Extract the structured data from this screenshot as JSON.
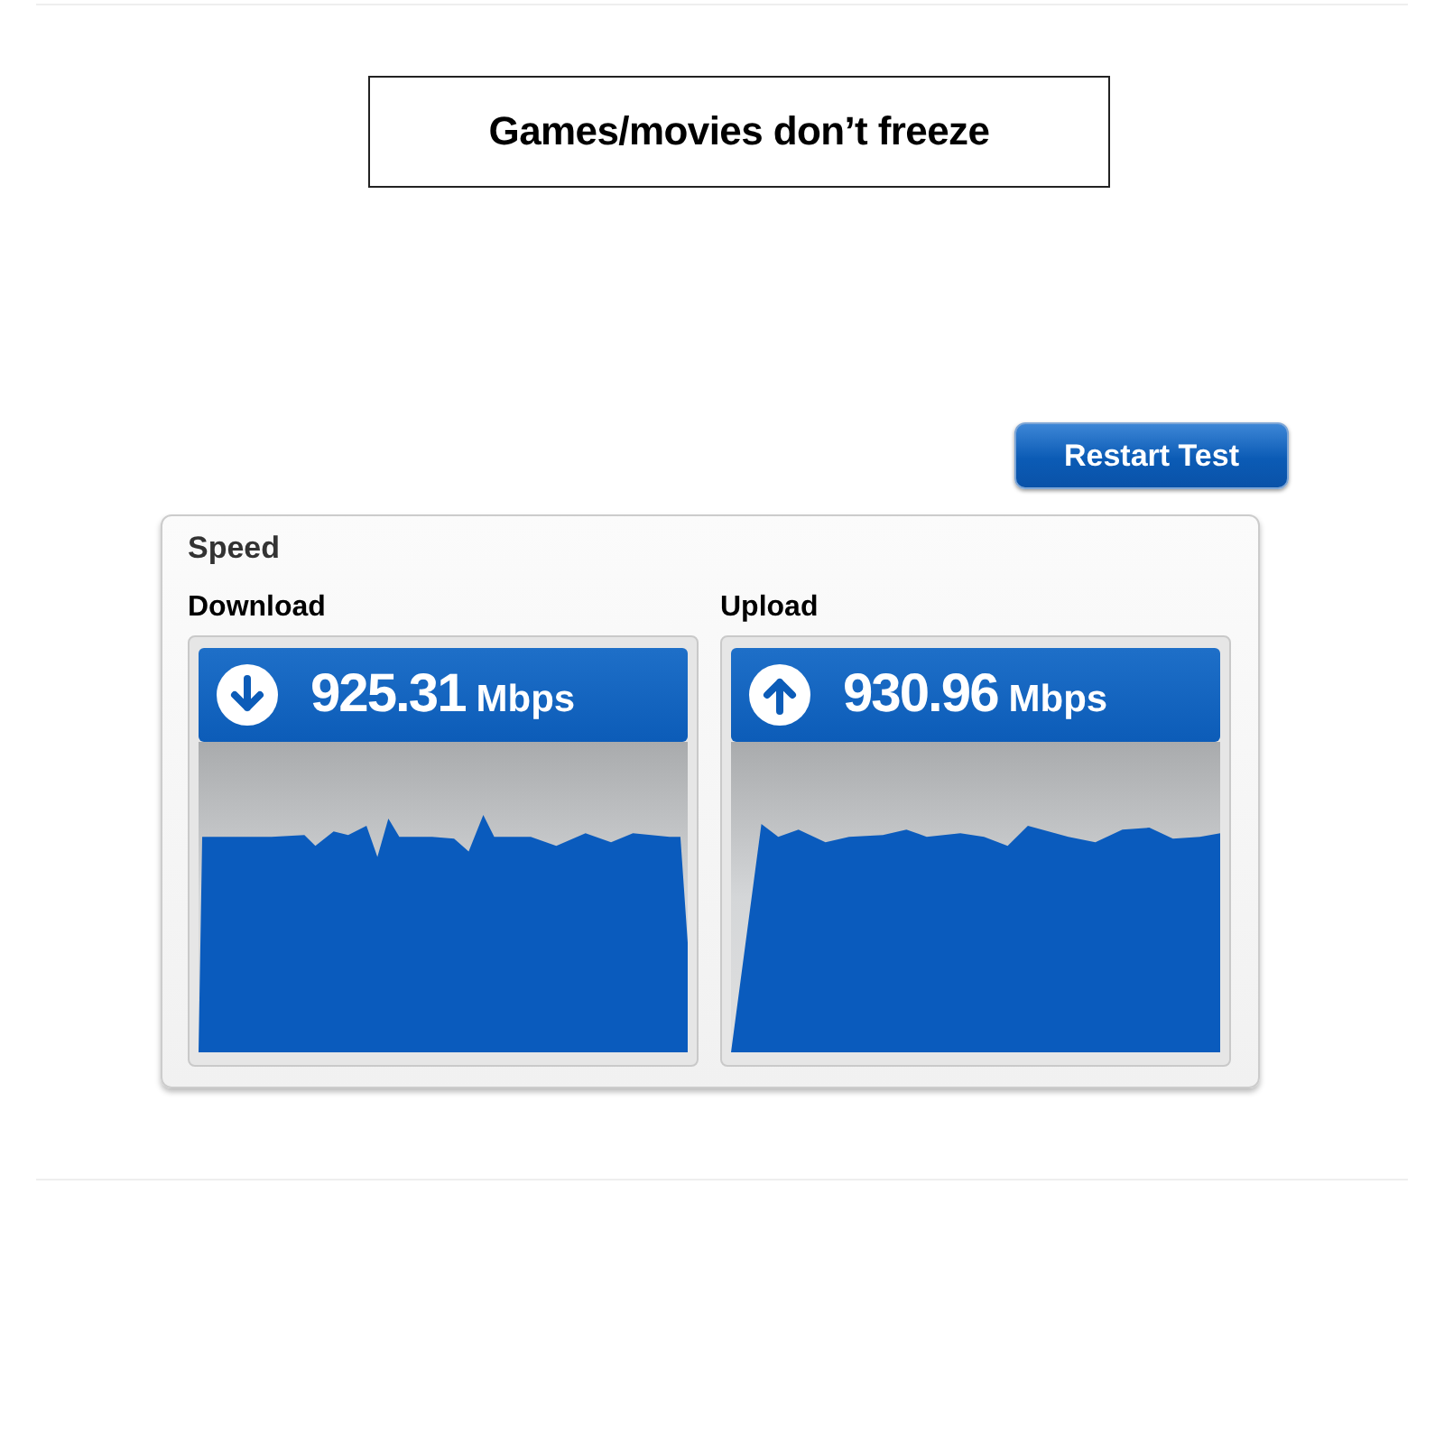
{
  "banner": {
    "title": "Games/movies don’t freeze"
  },
  "restart_button": {
    "label": "Restart Test"
  },
  "speed_panel": {
    "title": "Speed",
    "tests": [
      {
        "kind": "download",
        "label": "Download",
        "value": "925.31",
        "unit": "Mbps"
      },
      {
        "kind": "upload",
        "label": "Upload",
        "value": "930.96",
        "unit": "Mbps"
      }
    ]
  }
}
